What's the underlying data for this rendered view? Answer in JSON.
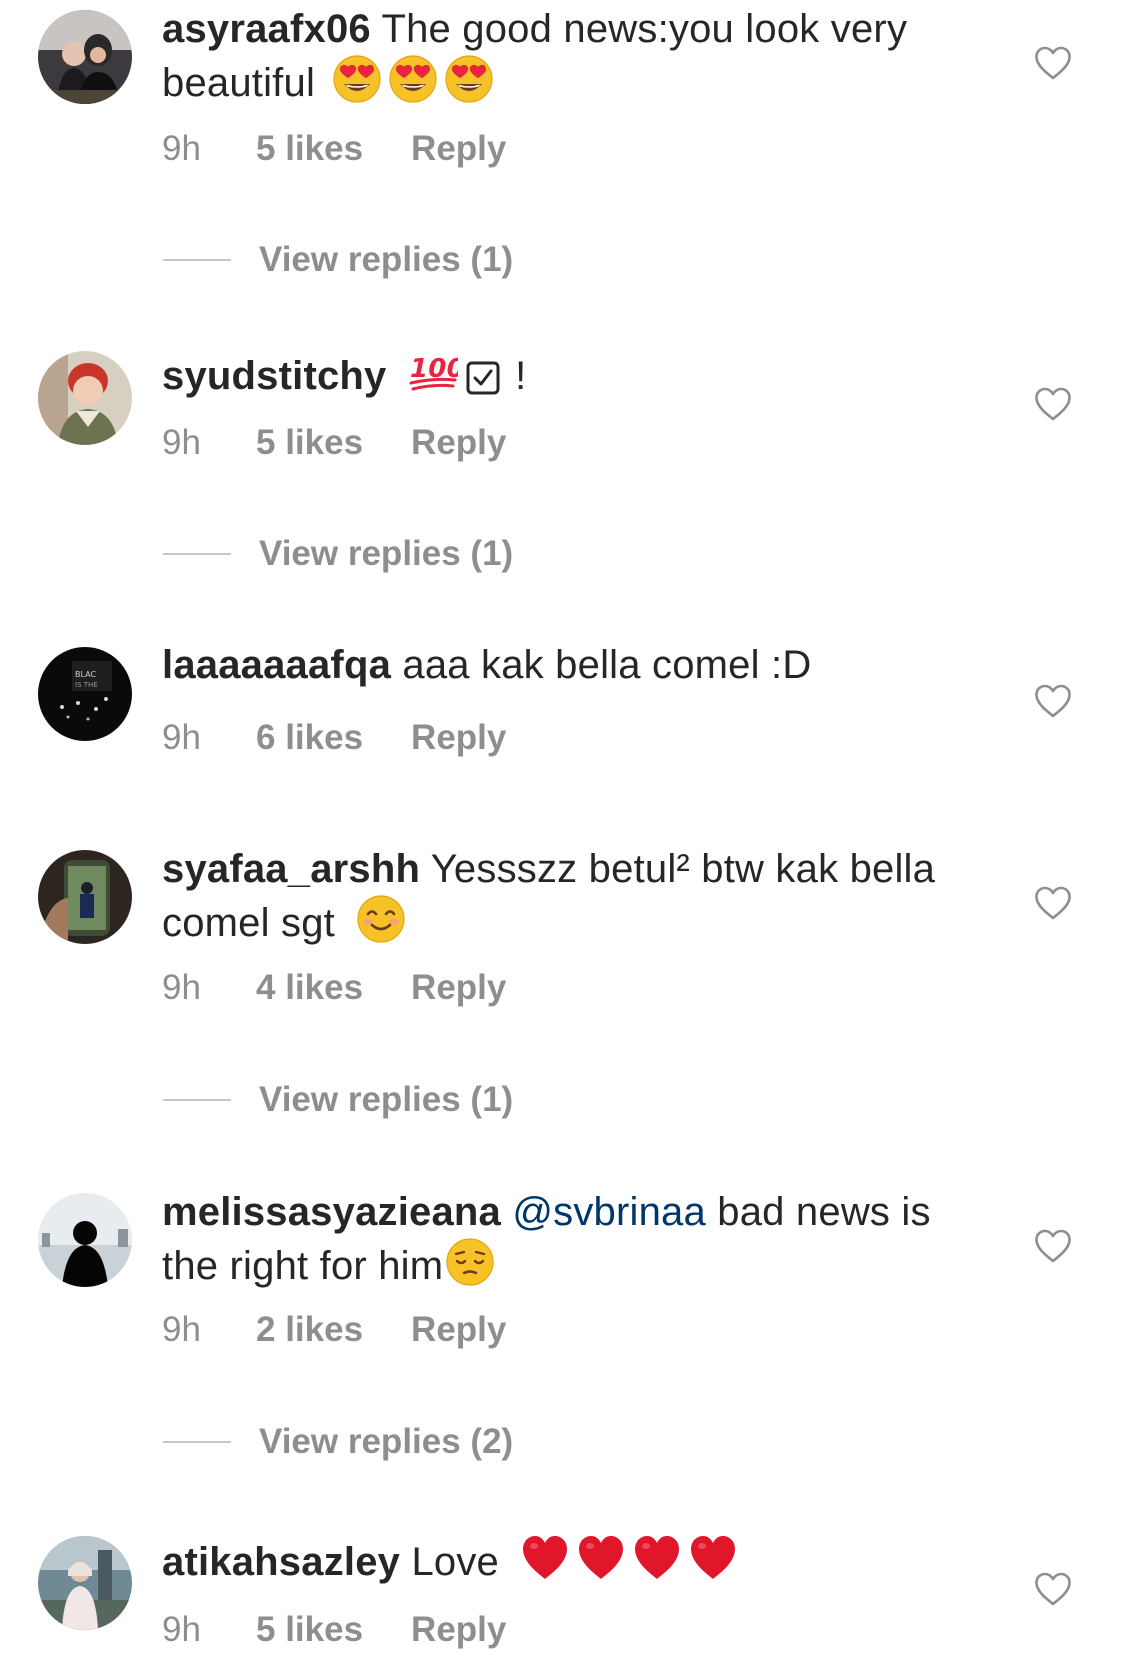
{
  "comments": [
    {
      "username": "asyraafx06",
      "text": "The good news:you look very beautiful",
      "emojis": [
        "heart-eyes",
        "heart-eyes",
        "heart-eyes"
      ],
      "time": "9h",
      "likes": "5 likes",
      "reply": "Reply",
      "view_replies": "View replies (1)"
    },
    {
      "username": "syudstitchy",
      "text": "",
      "emojis": [
        "hundred-points",
        "check-box"
      ],
      "trailing": "!",
      "time": "9h",
      "likes": "5 likes",
      "reply": "Reply",
      "view_replies": "View replies (1)"
    },
    {
      "username": "laaaaaaafqa",
      "text": "aaa kak bella comel :D",
      "time": "9h",
      "likes": "6 likes",
      "reply": "Reply"
    },
    {
      "username": "syafaa_arshh",
      "text": "Yessszz betul² btw kak bella comel sgt",
      "emojis": [
        "smiling-face"
      ],
      "time": "9h",
      "likes": "4 likes",
      "reply": "Reply",
      "view_replies": "View replies (1)"
    },
    {
      "username": "melissasyazieana",
      "mention": "@svbrinaa",
      "text": "bad news is the right for him",
      "emojis": [
        "pensive-face"
      ],
      "time": "9h",
      "likes": "2 likes",
      "reply": "Reply",
      "view_replies": "View replies (2)"
    },
    {
      "username": "atikahsazley",
      "text": "Love",
      "emojis": [
        "red-heart",
        "red-heart",
        "red-heart",
        "red-heart"
      ],
      "time": "9h",
      "likes": "5 likes",
      "reply": "Reply"
    }
  ],
  "colors": {
    "text": "#262626",
    "secondary": "#8e8e8e",
    "mention": "#00376b",
    "divider": "#c7c7c7"
  }
}
